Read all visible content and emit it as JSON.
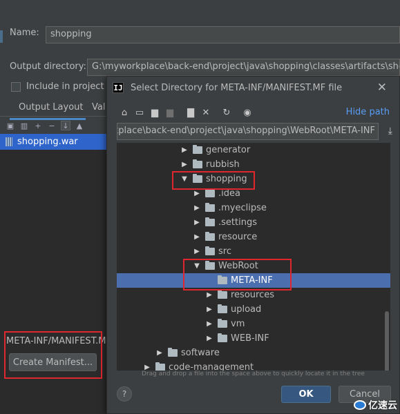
{
  "colors": {
    "accent": "#4a88c7",
    "selection": "#4b6eaf",
    "highlight_box": "#e0262e",
    "ok_button": "#365880",
    "link": "#589df6"
  },
  "settings": {
    "name_label": "Name:",
    "name_value": "shopping",
    "output_dir_label": "Output directory:",
    "output_dir_value": "G:\\myworkplace\\back-end\\project\\java\\shopping\\classes\\artifacts\\shopping",
    "include_label": "Include in project bu",
    "tabs": [
      {
        "label": "Output Layout"
      },
      {
        "label": "Val"
      }
    ],
    "tree_item": "shopping.war",
    "manifest_path": "META-INF/MANIFEST.MF",
    "create_manifest_label": "Create Manifest..."
  },
  "dialog": {
    "app_icon_letter": "IJ",
    "title": "Select Directory for META-INF/MANIFEST.MF file",
    "hide_path_label": "Hide path",
    "path_value": "G:\\myworkplace\\back-end\\project\\java\\shopping\\WebRoot\\META-INF",
    "toolbar_icons": [
      "home-icon",
      "desktop-icon",
      "project-folder-icon",
      "module-folder-icon",
      "new-folder-icon",
      "delete-icon",
      "refresh-icon",
      "show-hidden-icon"
    ],
    "tree": [
      {
        "label": "generator",
        "expanded": false
      },
      {
        "label": "rubbish",
        "expanded": false
      },
      {
        "label": "shopping",
        "expanded": true
      },
      {
        "label": ".idea",
        "expanded": false
      },
      {
        "label": ".myeclipse",
        "expanded": false
      },
      {
        "label": ".settings",
        "expanded": false
      },
      {
        "label": "resource",
        "expanded": false
      },
      {
        "label": "src",
        "expanded": false
      },
      {
        "label": "WebRoot",
        "expanded": true
      },
      {
        "label": "META-INF",
        "selected": true
      },
      {
        "label": "resources",
        "expanded": false
      },
      {
        "label": "upload",
        "expanded": false
      },
      {
        "label": "vm",
        "expanded": false
      },
      {
        "label": "WEB-INF",
        "expanded": false
      },
      {
        "label": "software",
        "expanded": false
      },
      {
        "label": "code-management",
        "expanded": false
      }
    ],
    "hint": "Drag and drop a file into the space above to quickly locate it in the tree",
    "help_label": "?",
    "ok_label": "OK",
    "cancel_label": "Cancel"
  },
  "watermark": {
    "text": "亿速云"
  }
}
